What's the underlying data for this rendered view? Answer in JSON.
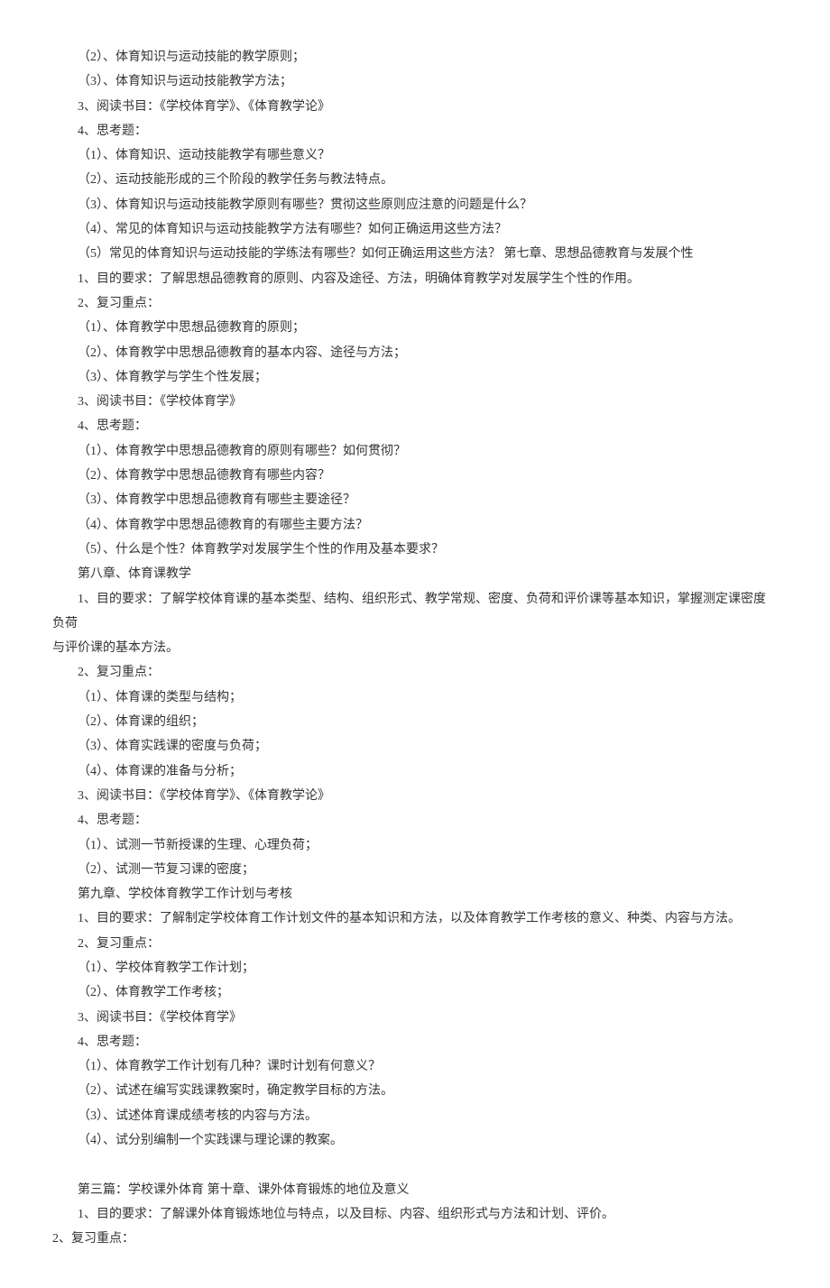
{
  "lines": [
    "（2）、体育知识与运动技能的教学原则；",
    "（3）、体育知识与运动技能教学方法；",
    "3、阅读书目：《学校体育学》、《体育教学论》",
    "4、思考题：",
    "（1）、体育知识、运动技能教学有哪些意义？",
    "（2）、运动技能形成的三个阶段的教学任务与教法特点。",
    "（3）、体育知识与运动技能教学原则有哪些？贯彻这些原则应注意的问题是什么？",
    "（4）、常见的体育知识与运动技能教学方法有哪些？如何正确运用这些方法？",
    "（5）常见的体育知识与运动技能的学练法有哪些？如何正确运用这些方法？ 第七章、思想品德教育与发展个性",
    "1、目的要求：了解思想品德教育的原则、内容及途径、方法，明确体育教学对发展学生个性的作用。",
    "2、复习重点：",
    "（1）、体育教学中思想品德教育的原则；",
    "（2）、体育教学中思想品德教育的基本内容、途径与方法；",
    "（3）、体育教学与学生个性发展；",
    "3、阅读书目：《学校体育学》",
    "4、思考题：",
    "（1）、体育教学中思想品德教育的原则有哪些？如何贯彻？",
    "（2）、体育教学中思想品德教育有哪些内容？",
    "（3）、体育教学中思想品德教育有哪些主要途径？",
    "（4）、体育教学中思想品德教育的有哪些主要方法？",
    "（5）、什么是个性？体育教学对发展学生个性的作用及基本要求？",
    "第八章、体育课教学"
  ],
  "para1_a": "1、目的要求：了解学校体育课的基本类型、结构、组织形式、教学常规、密度、负荷和评价课等基本知识，掌握测定课密度 负荷",
  "para1_b": "与评价课的基本方法。",
  "lines2": [
    "2、复习重点：",
    "（1）、体育课的类型与结构；",
    "（2）、体育课的组织；",
    "（3）、体育实践课的密度与负荷；",
    "（4）、体育课的准备与分析；",
    "3、阅读书目：《学校体育学》、《体育教学论》",
    "4、思考题：",
    "（1）、试测一节新授课的生理、心理负荷；",
    "（2）、试测一节复习课的密度；",
    "第九章、学校体育教学工作计划与考核",
    "1、目的要求：了解制定学校体育工作计划文件的基本知识和方法，以及体育教学工作考核的意义、种类、内容与方法。",
    "2、复习重点：",
    "（1）、学校体育教学工作计划；",
    "（2）、体育教学工作考核；",
    "3、阅读书目：《学校体育学》",
    "4、思考题：",
    "（1）、体育教学工作计划有几种？课时计划有何意义？",
    "（2）、试述在编写实践课教案时，确定教学目标的方法。",
    "（3）、试述体育课成绩考核的内容与方法。",
    "（4）、试分别编制一个实践课与理论课的教案。"
  ],
  "lines3": [
    "第三篇：学校课外体育 第十章、课外体育锻炼的地位及意义",
    "1、目的要求：了解课外体育锻炼地位与特点，以及目标、内容、组织形式与方法和计划、评价。"
  ],
  "last": "2、复习重点："
}
